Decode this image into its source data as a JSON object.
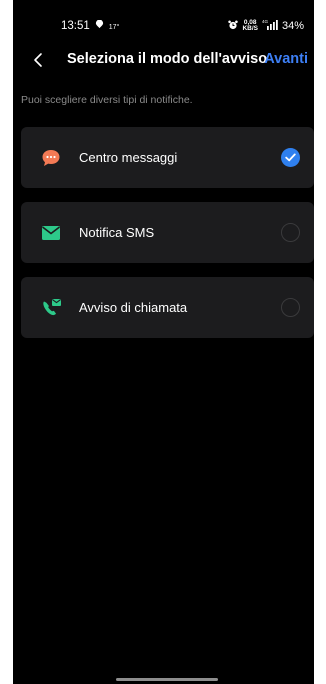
{
  "status_bar": {
    "time": "13:51",
    "temperature": "17°",
    "speed_value": "0,08",
    "speed_unit": "KB/S",
    "network": "4G",
    "battery": "34%"
  },
  "header": {
    "title": "Seleziona il modo dell'avviso",
    "next_label": "Avanti"
  },
  "hint": "Puoi scegliere diversi tipi di notifiche.",
  "options": [
    {
      "label": "Centro messaggi",
      "icon": "chat-bubble-icon",
      "icon_color": "#f47a55",
      "checked": true
    },
    {
      "label": "Notifica SMS",
      "icon": "envelope-icon",
      "icon_color": "#2dc98a",
      "checked": false
    },
    {
      "label": "Avviso di chiamata",
      "icon": "phone-call-icon",
      "icon_color": "#2dc98a",
      "checked": false
    }
  ],
  "colors": {
    "accent": "#2f80ef",
    "background": "#000000",
    "card": "#1c1c1e"
  }
}
